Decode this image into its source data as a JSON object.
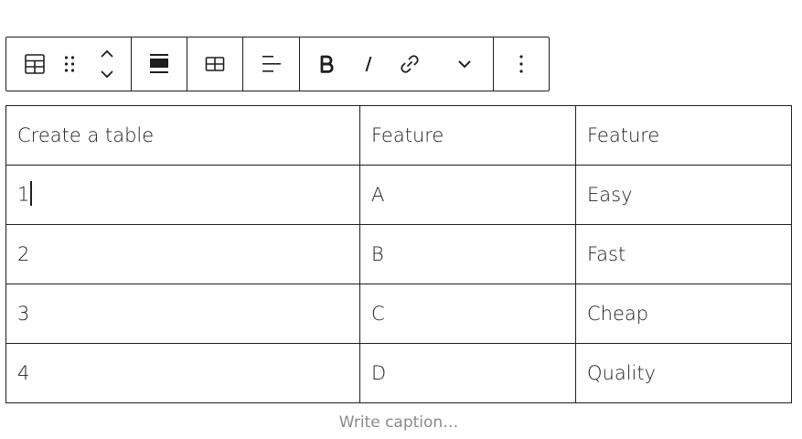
{
  "toolbar": {
    "block_group": [
      {
        "icon": "table-icon"
      },
      {
        "icon": "drag-handle-icon"
      },
      {
        "icon": "move-up-down-icon"
      }
    ],
    "align_group": [
      {
        "icon": "align-wide-icon"
      }
    ],
    "table_group": [
      {
        "icon": "table-edit-icon"
      }
    ],
    "text_align_group": [
      {
        "icon": "align-text-left-icon"
      }
    ],
    "format_group": [
      {
        "icon": "bold-icon"
      },
      {
        "icon": "italic-icon"
      },
      {
        "icon": "link-icon"
      },
      {
        "icon": "chevron-down-icon"
      }
    ],
    "more_group": [
      {
        "icon": "more-vertical-icon"
      }
    ]
  },
  "table": {
    "rows": [
      [
        "Create a table",
        "Feature",
        "Feature"
      ],
      [
        "1",
        "A",
        "Easy"
      ],
      [
        "2",
        "B",
        "Fast"
      ],
      [
        "3",
        "C",
        "Cheap"
      ],
      [
        "4",
        "D",
        "Quality"
      ]
    ]
  },
  "caption": {
    "placeholder": "Write caption…"
  }
}
